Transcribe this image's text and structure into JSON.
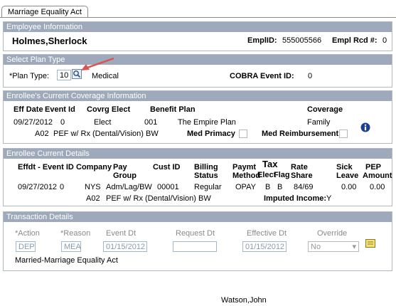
{
  "tab": {
    "label": "Marriage Equality Act"
  },
  "employee": {
    "header": "Employee Information",
    "name": "Holmes,Sherlock",
    "emplid_label": "EmplID:",
    "emplid_value": "555005566",
    "rcd_label": "Empl Rcd #:",
    "rcd_value": "0"
  },
  "plan": {
    "header": "Select Plan Type",
    "plan_type_label": "*Plan Type:",
    "plan_type_value": "10",
    "plan_type_desc": "Medical",
    "cobra_label": "COBRA Event ID:",
    "cobra_value": "0"
  },
  "coverage": {
    "header": "Enrollee's Current Coverage Information",
    "col_eff": "Eff Date",
    "col_event": "Event Id",
    "col_covrg": "Covrg Elect",
    "col_benefit": "Benefit Plan",
    "col_coverage": "Coverage",
    "eff_date": "09/27/2012",
    "event_id": "0",
    "covrg_elect": "Elect",
    "plan_code": "001",
    "plan_name": "The Empire Plan",
    "coverage_value": "Family",
    "code": "A02",
    "desc": "PEF w/ Rx (Dental/Vision) BW",
    "med_primacy_label": "Med Primacy",
    "med_reimb_label": "Med Reimbursement"
  },
  "details": {
    "header": "Enrollee Current Details",
    "col_effdt": "Effdt - Event ID",
    "col_company": "Company",
    "col_pay1": "Pay",
    "col_pay2": "Group",
    "col_custid": "Cust ID",
    "col_billing1": "Billing",
    "col_billing2": "Status",
    "col_paymt1": "Paymt",
    "col_paymt2": "Method",
    "col_tax": "Tax",
    "col_elect": "Elect",
    "col_flag": "Flag",
    "col_rate1": "Rate",
    "col_rate2": "Share",
    "col_sick1": "Sick",
    "col_sick2": "Leave",
    "col_pep1": "PEP",
    "col_pep2": "Amount",
    "effdt": "09/27/2012",
    "event_id": "0",
    "company": "NYS",
    "pay_group": "Adm/Lag/BW",
    "cust_id": "00001",
    "billing": "Regular",
    "paymt": "OPAY",
    "elect": "B",
    "flag": "B",
    "rate_share": "84/69",
    "sick": "0.00",
    "pep": "0.00",
    "code": "A02",
    "desc": "PEF w/ Rx (Dental/Vision) BW",
    "imputed_label": "Imputed Income:",
    "imputed_value": "Y"
  },
  "transaction": {
    "header": "Transaction Details",
    "action_label": "*Action",
    "reason_label": "*Reason",
    "event_dt_label": "Event Dt",
    "request_dt_label": "Request Dt",
    "effective_dt_label": "Effective Dt",
    "override_label": "Override",
    "action_value": "DEP",
    "reason_value": "MEA",
    "event_dt_value": "01/15/2012",
    "request_dt_value": "",
    "effective_dt_value": "01/15/2012",
    "override_value": "No",
    "description": "Married-Marriage Equality Act"
  },
  "footer": {
    "user": "Watson,John"
  },
  "colors": {
    "section_header": "#9eaabb",
    "arrow": "#d9534f",
    "info_icon": "#1c3f94"
  }
}
